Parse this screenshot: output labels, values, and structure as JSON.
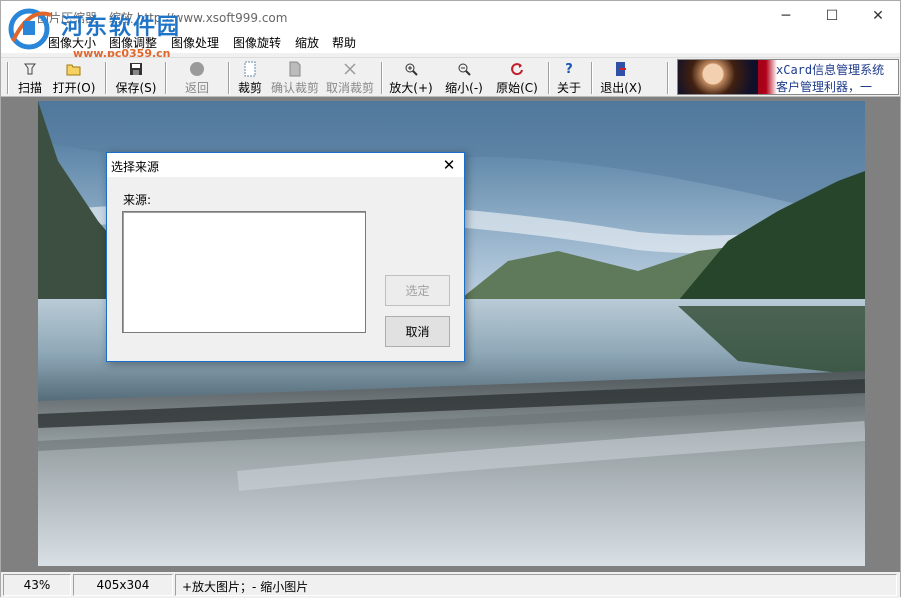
{
  "window": {
    "title": "图片压缩器 - 缩放  http://www.xsoft999.com",
    "minimize": "─",
    "maximize": "☐",
    "close": "✕"
  },
  "watermark": {
    "name": "河东软件园",
    "url": "www.pc0359.cn"
  },
  "menu": [
    "图像大小",
    "图像调整",
    "图像处理",
    "图像旋转",
    "缩放",
    "帮助"
  ],
  "toolbar": {
    "scan": "扫描",
    "open": "打开(O)",
    "save": "保存(S)",
    "back": "返回",
    "crop": "裁剪",
    "confirm_crop": "确认裁剪",
    "cancel_crop": "取消裁剪",
    "zoom_in": "放大(+)",
    "zoom_out": "缩小(-)",
    "original": "原始(C)",
    "about": "关于",
    "exit": "退出(X)"
  },
  "ad": {
    "line1": "xCard信息管理系统",
    "line2": "客户管理利器，一"
  },
  "dialog": {
    "title": "选择来源",
    "close": "✕",
    "source_label": "来源:",
    "select_button": "选定",
    "cancel_button": "取消",
    "sources": []
  },
  "status": {
    "zoom": "43%",
    "size": "405x304",
    "hint": "+放大图片；- 缩小图片"
  }
}
